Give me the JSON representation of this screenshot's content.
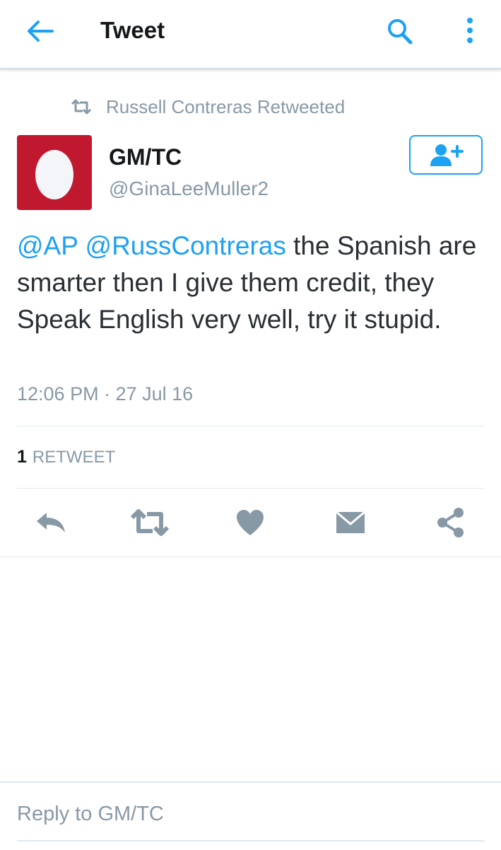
{
  "header": {
    "title": "Tweet",
    "icons": {
      "back": "arrow-left-icon",
      "search": "search-icon",
      "more": "more-vertical-icon"
    },
    "accent_color": "#1da1f2"
  },
  "retweet_context": {
    "icon": "retweet-icon",
    "text": "Russell Contreras Retweeted"
  },
  "tweet": {
    "author": {
      "name": "GM/TC",
      "handle": "@GinaLeeMuller2",
      "avatar_color": "#c0182f",
      "avatar_icon": "default-egg-avatar"
    },
    "follow_icon": "follow-user-icon",
    "text": {
      "mention_1": "@AP",
      "mention_2": "@RussContreras",
      "body": " the Spanish are smarter then I give them credit, they Speak English very well, try it stupid."
    },
    "timestamp": "12:06 PM · 27 Jul 16",
    "stats": {
      "retweet_count": "1",
      "retweet_label": "RETWEET"
    }
  },
  "actions": [
    {
      "name": "reply",
      "icon": "reply-icon"
    },
    {
      "name": "retweet",
      "icon": "retweet-icon"
    },
    {
      "name": "like",
      "icon": "heart-icon"
    },
    {
      "name": "direct-message",
      "icon": "envelope-icon"
    },
    {
      "name": "share",
      "icon": "share-icon"
    }
  ],
  "reply": {
    "placeholder": "Reply to GM/TC"
  }
}
